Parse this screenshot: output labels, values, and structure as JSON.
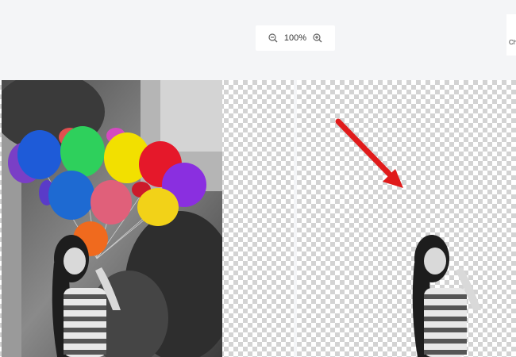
{
  "zoom": {
    "level": "100%",
    "out_icon": "zoom-out-icon",
    "in_icon": "zoom-in-icon"
  },
  "side_panel": {
    "text": "Ch ba"
  },
  "colors": {
    "background": "#f4f5f7",
    "arrow": "#e01b1b",
    "checker": "#d3d3d3"
  },
  "images": {
    "original": "balloon-girl-photo",
    "result": "cutout-result"
  }
}
